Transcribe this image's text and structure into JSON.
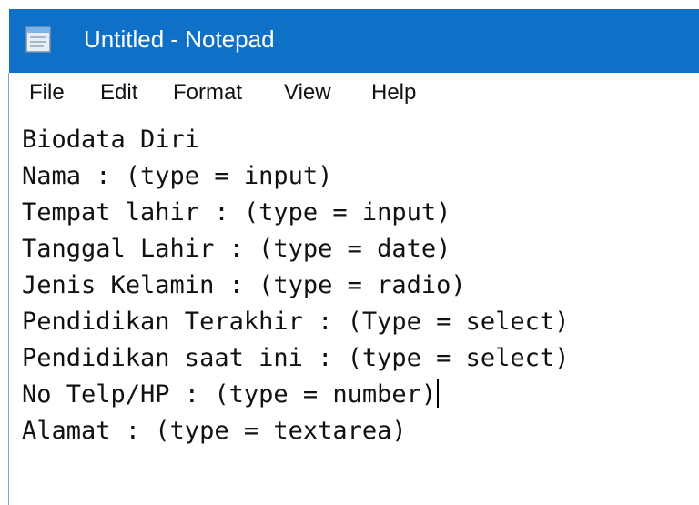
{
  "window": {
    "title": "Untitled - Notepad",
    "icon": "notepad-icon",
    "accent_color": "#0f70c8"
  },
  "menu": [
    {
      "label": "File"
    },
    {
      "label": "Edit"
    },
    {
      "label": "Format"
    },
    {
      "label": "View"
    },
    {
      "label": "Help"
    }
  ],
  "document": {
    "lines": [
      "Biodata Diri",
      "Nama : (type = input)",
      "Tempat lahir : (type = input)",
      "Tanggal Lahir : (type = date)",
      "Jenis Kelamin : (type = radio)",
      "Pendidikan Terakhir : (Type = select)",
      "Pendidikan saat ini : (type = select)",
      "No Telp/HP : (type = number)",
      "Alamat : (type = textarea)"
    ],
    "caret_line": 7
  }
}
